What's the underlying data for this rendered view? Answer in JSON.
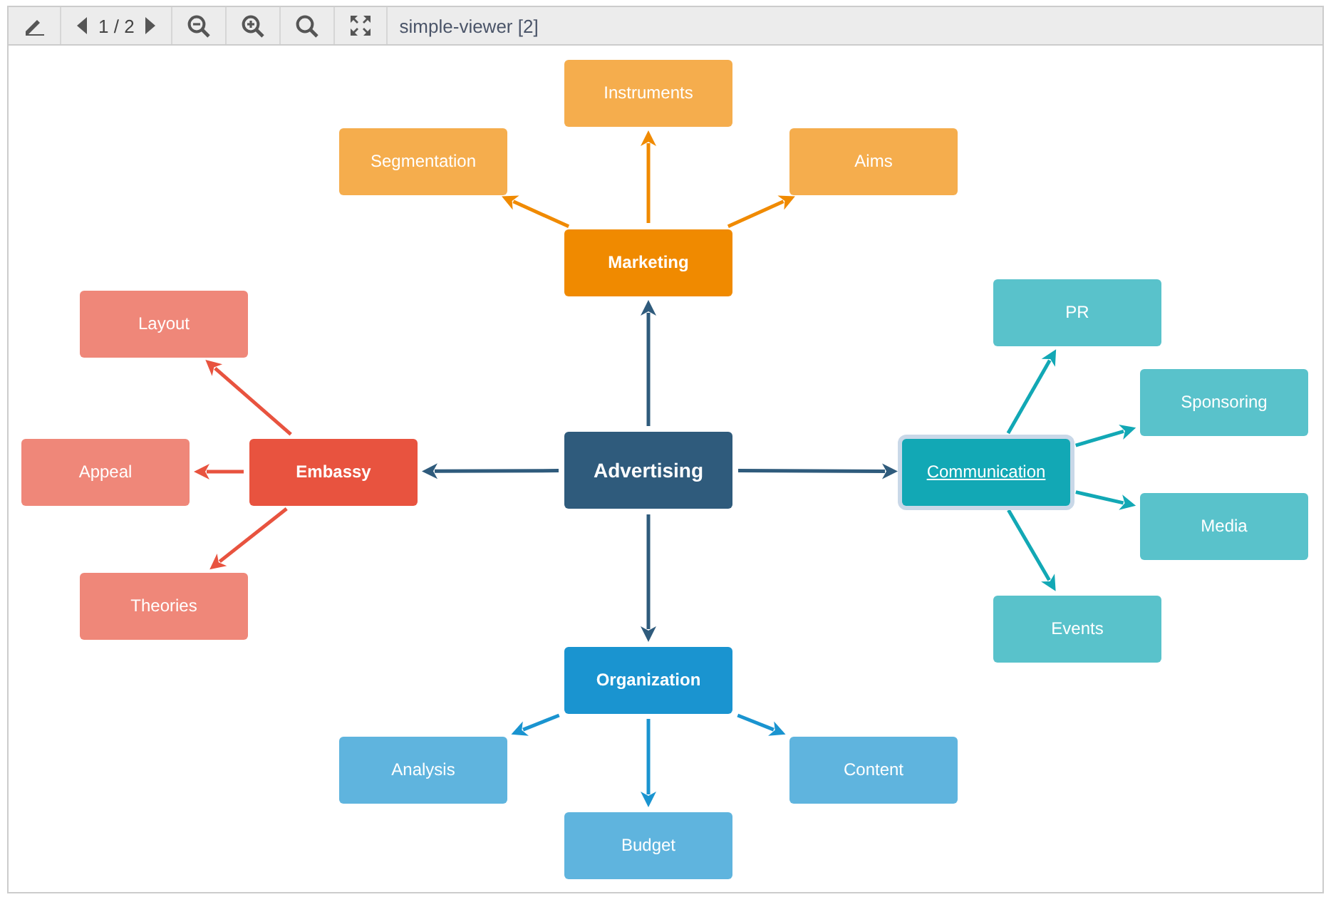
{
  "toolbar": {
    "page": "1 / 2",
    "title": "simple-viewer [2]"
  },
  "mindmap": {
    "root": {
      "label": "Advertising",
      "color": "#2f5b7c"
    },
    "branches": [
      {
        "label": "Marketing",
        "color": "#f08a00",
        "selected": false,
        "children": [
          {
            "label": "Segmentation"
          },
          {
            "label": "Instruments"
          },
          {
            "label": "Aims"
          }
        ]
      },
      {
        "label": "Embassy",
        "color": "#e8533f",
        "selected": false,
        "children": [
          {
            "label": "Layout"
          },
          {
            "label": "Appeal"
          },
          {
            "label": "Theories"
          }
        ]
      },
      {
        "label": "Communication",
        "color": "#12a8b5",
        "selected": true,
        "children": [
          {
            "label": "PR"
          },
          {
            "label": "Sponsoring"
          },
          {
            "label": "Media"
          },
          {
            "label": "Events"
          }
        ]
      },
      {
        "label": "Organization",
        "color": "#1a94d0",
        "selected": false,
        "children": [
          {
            "label": "Analysis"
          },
          {
            "label": "Budget"
          },
          {
            "label": "Content"
          }
        ]
      }
    ]
  }
}
